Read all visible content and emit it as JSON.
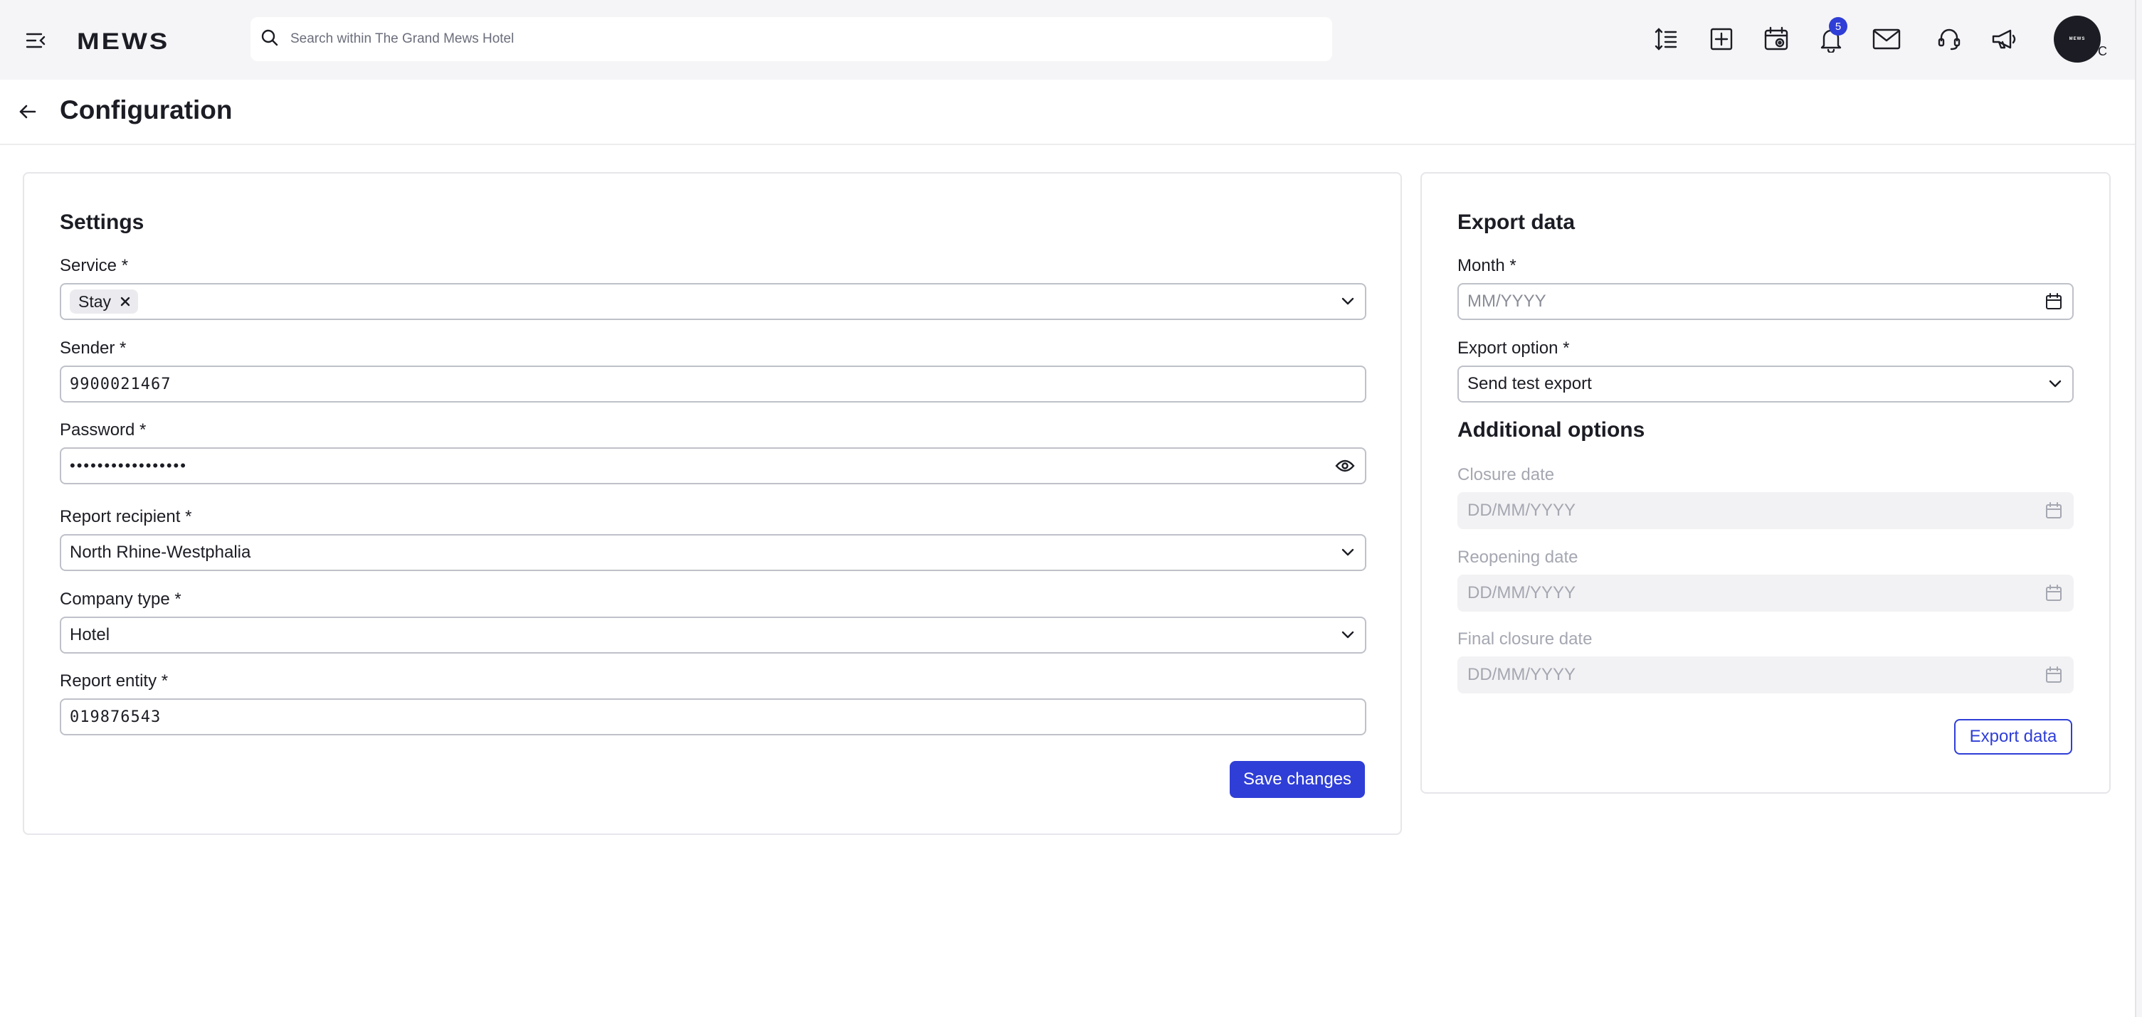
{
  "topbar": {
    "logo_text": "MEWS",
    "search_placeholder": "Search within The Grand Mews Hotel",
    "notification_count": "5",
    "avatar_text": "MEWS",
    "avatar_letter": "C"
  },
  "header": {
    "title": "Configuration"
  },
  "settings": {
    "title": "Settings",
    "service": {
      "label": "Service *",
      "chip": "Stay"
    },
    "sender": {
      "label": "Sender *",
      "value": "9900021467"
    },
    "password": {
      "label": "Password *",
      "masked": "•••••••••••••••••"
    },
    "report_recipient": {
      "label": "Report recipient *",
      "value": "North Rhine-Westphalia"
    },
    "company_type": {
      "label": "Company type *",
      "value": "Hotel"
    },
    "report_entity": {
      "label": "Report entity *",
      "value": "019876543"
    },
    "save_label": "Save changes"
  },
  "export": {
    "title": "Export data",
    "month": {
      "label": "Month *",
      "placeholder": "MM/YYYY"
    },
    "export_option": {
      "label": "Export option *",
      "value": "Send test export"
    },
    "additional_title": "Additional options",
    "closure_date": {
      "label": "Closure date",
      "placeholder": "DD/MM/YYYY"
    },
    "reopening_date": {
      "label": "Reopening date",
      "placeholder": "DD/MM/YYYY"
    },
    "final_closure_date": {
      "label": "Final closure date",
      "placeholder": "DD/MM/YYYY"
    },
    "export_label": "Export data"
  },
  "colors": {
    "accent": "#2f3ed6",
    "disabled_text": "#a5a7b1",
    "field_border": "#bfc1c9"
  }
}
